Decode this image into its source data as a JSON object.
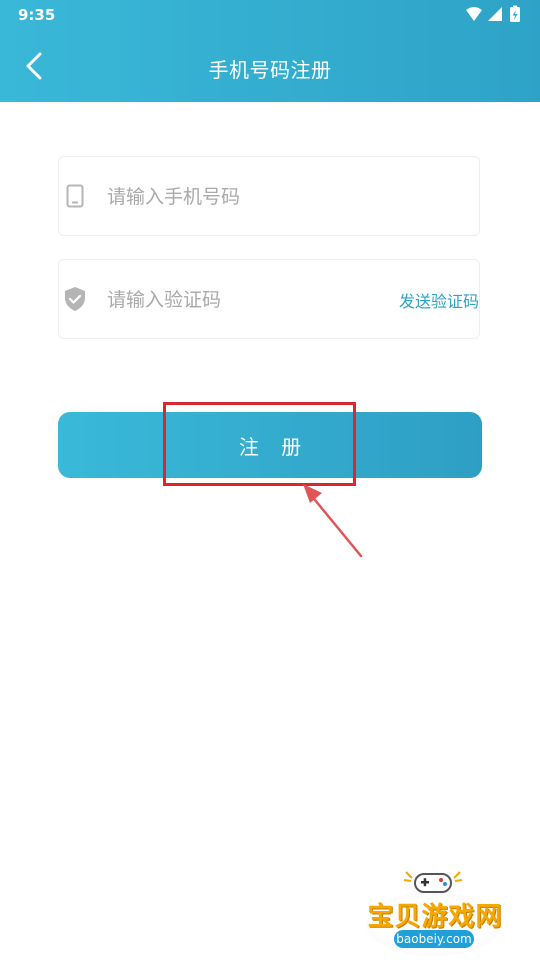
{
  "status_bar": {
    "time": "9:35",
    "icons": [
      "wifi-icon",
      "cellular-signal-icon",
      "battery-charging-icon"
    ]
  },
  "header": {
    "title": "手机号码注册",
    "back_icon": "chevron-left-icon"
  },
  "form": {
    "phone": {
      "placeholder": "请输入手机号码",
      "value": "",
      "icon": "phone-icon"
    },
    "code": {
      "placeholder": "请输入验证码",
      "value": "",
      "icon": "shield-check-icon",
      "send_code_label": "发送验证码"
    },
    "submit_label": "注 册"
  },
  "annotation": {
    "highlight_color": "#d9272e"
  },
  "watermark": {
    "name": "宝贝游戏网",
    "domain": "baobeiy.com"
  },
  "colors": {
    "header": "#2fa9cd",
    "accent": "#2ea3c7",
    "placeholder": "#a9a9a9",
    "icon_gray": "#b5b5b5"
  }
}
